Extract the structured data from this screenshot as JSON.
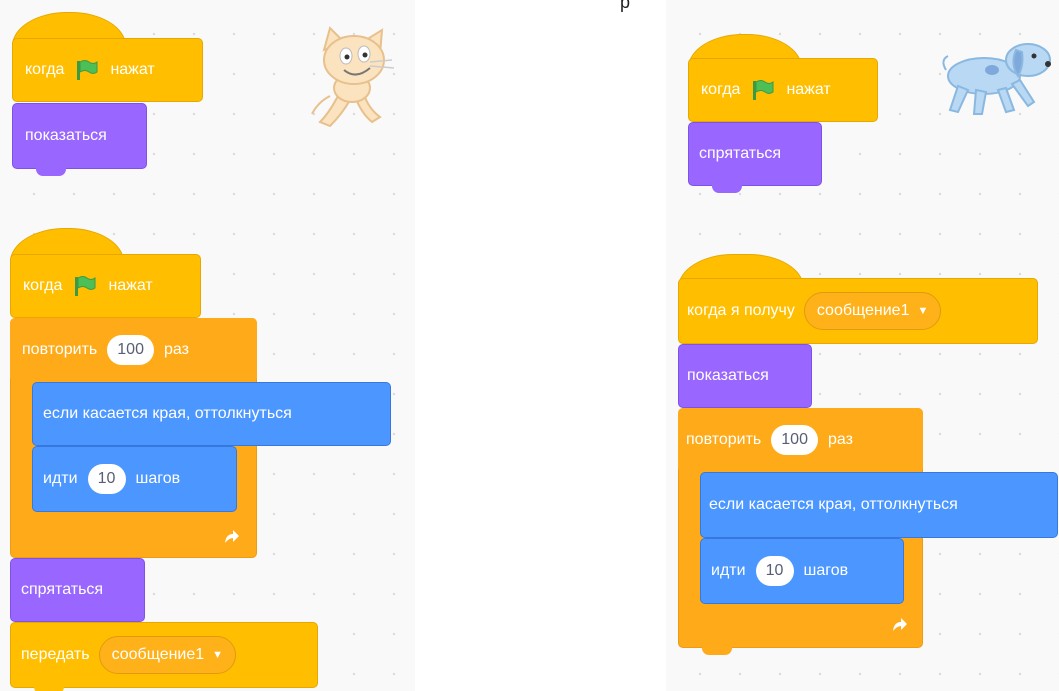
{
  "top_caption": "р",
  "left_script": {
    "hat1": {
      "when": "когда",
      "clicked": "нажат"
    },
    "show": "показаться",
    "hat2": {
      "when": "когда",
      "clicked": "нажат"
    },
    "repeat": {
      "label": "повторить",
      "count": "100",
      "times": "раз"
    },
    "bounce": "если касается края, оттолкнуться",
    "move": {
      "label": "идти",
      "steps": "10",
      "unit": "шагов"
    },
    "hide": "спрятаться",
    "broadcast": {
      "label": "передать",
      "message": "сообщение1"
    }
  },
  "right_script": {
    "hat1": {
      "when": "когда",
      "clicked": "нажат"
    },
    "hide": "спрятаться",
    "receive": {
      "label": "когда я получу",
      "message": "сообщение1"
    },
    "show": "показаться",
    "repeat": {
      "label": "повторить",
      "count": "100",
      "times": "раз"
    },
    "bounce": "если касается края, оттолкнуться",
    "move": {
      "label": "идти",
      "steps": "10",
      "unit": "шагов"
    }
  },
  "colors": {
    "events": "#ffbf00",
    "looks": "#9966ff",
    "motion": "#4c97ff",
    "control": "#ffab19",
    "flag": "#4cbf56"
  },
  "sprites": [
    "cat-sprite",
    "dog-sprite"
  ]
}
